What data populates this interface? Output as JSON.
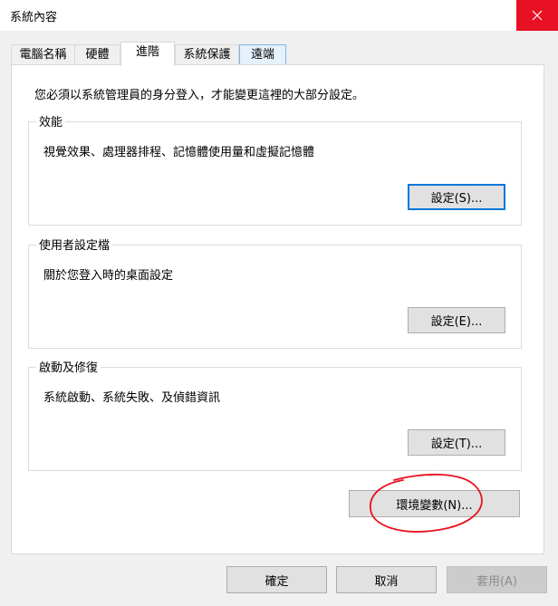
{
  "window": {
    "title": "系統內容"
  },
  "tabs": [
    {
      "label": "電腦名稱"
    },
    {
      "label": "硬體"
    },
    {
      "label": "進階"
    },
    {
      "label": "系統保護"
    },
    {
      "label": "遠端"
    }
  ],
  "notice": "您必須以系統管理員的身分登入，才能變更這裡的大部分設定。",
  "groups": {
    "performance": {
      "title": "效能",
      "desc": "視覺效果、處理器排程、記憶體使用量和虛擬記憶體",
      "button": "設定(S)..."
    },
    "profiles": {
      "title": "使用者設定檔",
      "desc": "關於您登入時的桌面設定",
      "button": "設定(E)..."
    },
    "startup": {
      "title": "啟動及修復",
      "desc": "系統啟動、系統失敗、及偵錯資訊",
      "button": "設定(T)..."
    }
  },
  "env_button": "環境變數(N)...",
  "footer": {
    "ok": "確定",
    "cancel": "取消",
    "apply": "套用(A)"
  },
  "colors": {
    "accent": "#0078d7",
    "close": "#e81123",
    "annotation": "#e8131f"
  },
  "icons": {
    "close": "close-icon"
  }
}
